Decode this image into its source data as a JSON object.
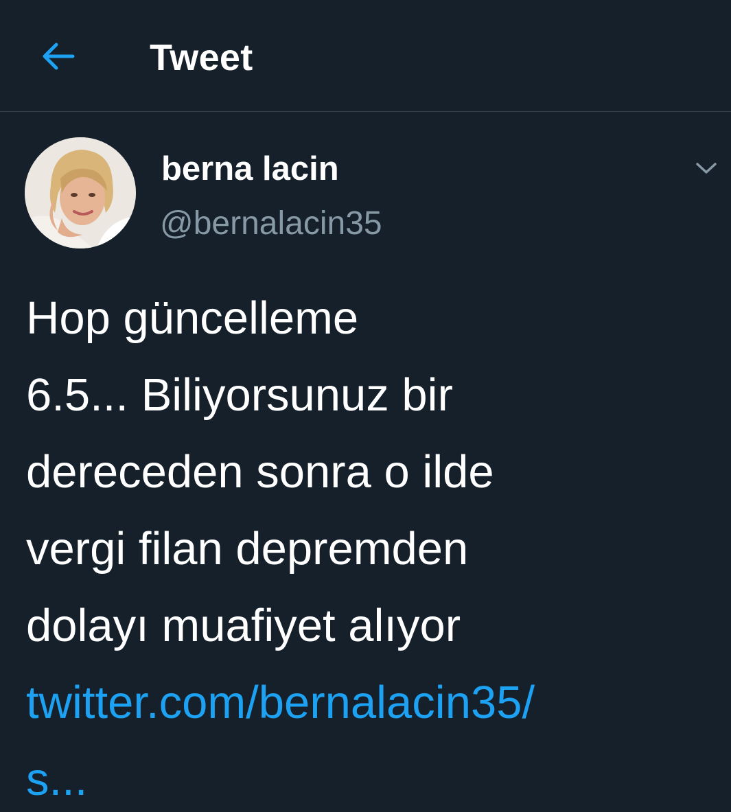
{
  "header": {
    "title": "Tweet",
    "back_icon": "arrow-left-icon"
  },
  "author": {
    "display_name": "berna lacin",
    "handle": "@bernalacin35"
  },
  "tweet": {
    "lines": [
      "Hop güncelleme",
      "6.5... Biliyorsunuz bir",
      "dereceden sonra o ilde",
      "vergi filan depremden",
      "dolayı muafiyet alıyor"
    ],
    "link_lines": [
      "twitter.com/bernalacin35/",
      "s..."
    ]
  },
  "colors": {
    "background": "#15202b",
    "accent": "#1da1f2",
    "secondary_text": "#8899a6",
    "divider": "#38444d"
  }
}
